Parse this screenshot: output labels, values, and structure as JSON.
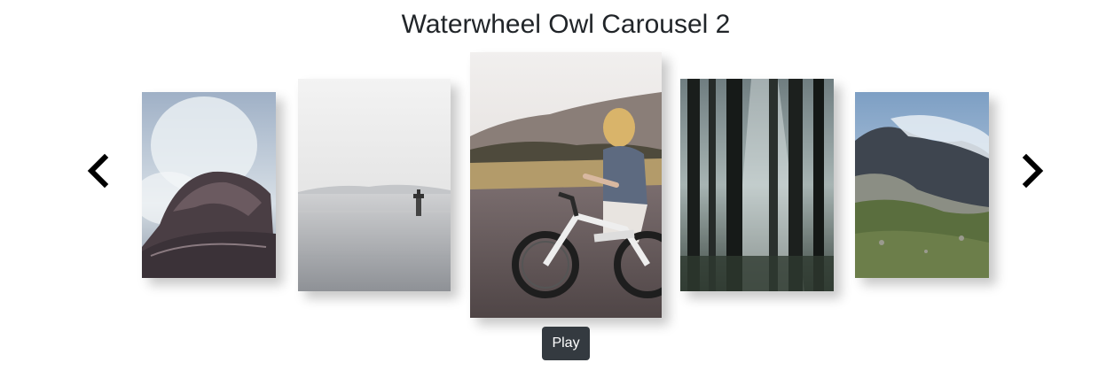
{
  "header": {
    "title": "Waterwheel Owl Carousel 2"
  },
  "carousel": {
    "prev_icon": "chevron-left-icon",
    "next_icon": "chevron-right-icon",
    "slides": [
      {
        "subject": "waves crashing on rocks"
      },
      {
        "subject": "foggy sea with lifeguard tower"
      },
      {
        "subject": "girl riding e-bike on road"
      },
      {
        "subject": "sunlit forest trees"
      },
      {
        "subject": "misty mountain valley"
      }
    ]
  },
  "controls": {
    "play_label": "Play"
  },
  "colors": {
    "button_bg": "#343a40",
    "button_text": "#ffffff",
    "title_text": "#212529",
    "arrow": "#000000"
  }
}
